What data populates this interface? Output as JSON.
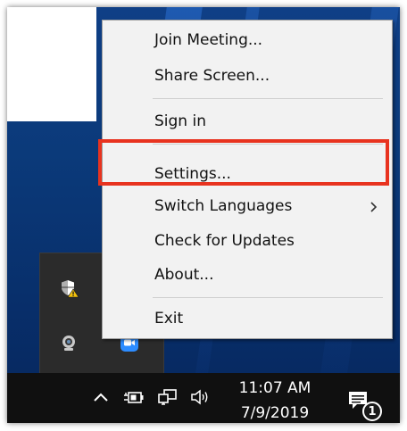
{
  "menu": {
    "items": [
      {
        "label": "Join Meeting..."
      },
      {
        "label": "Share Screen..."
      },
      {
        "label": "Sign in"
      },
      {
        "label": "Settings..."
      },
      {
        "label": "Switch Languages",
        "submenu": true
      },
      {
        "label": "Check for Updates"
      },
      {
        "label": "About..."
      },
      {
        "label": "Exit"
      }
    ],
    "highlighted_item": "Settings...",
    "highlight_color": "#e8331f"
  },
  "tray_overflow": {
    "icons": [
      "security-warning-icon",
      "webcam-icon",
      "zoom-app-icon"
    ]
  },
  "taskbar": {
    "icons": [
      "chevron-up-icon",
      "battery-icon",
      "network-icon",
      "volume-icon",
      "notification-icon"
    ],
    "time": "11:07 AM",
    "date": "7/9/2019",
    "notification_count": "1"
  },
  "colors": {
    "desktop": "#0b3a7a",
    "menu_bg": "#f2f2f2",
    "taskbar_bg": "#101010",
    "zoom_blue": "#2d8cff"
  }
}
